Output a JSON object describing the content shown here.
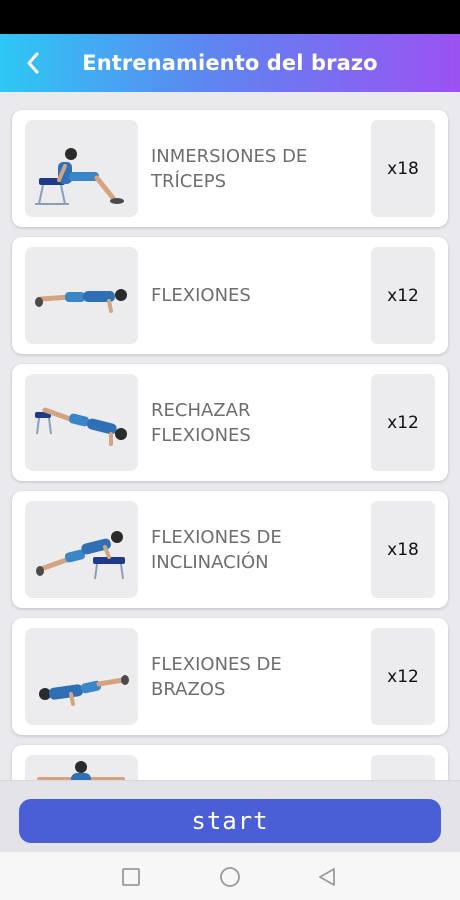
{
  "app_bar": {
    "title": "Entrenamiento del brazo",
    "back_icon": "chevron-left-icon",
    "gradient": [
      "#2ec8f4",
      "#9b52f2"
    ]
  },
  "exercises": [
    {
      "name": "INMERSIONES DE TRÍCEPS",
      "reps": "x18"
    },
    {
      "name": "FLEXIONES",
      "reps": "x12"
    },
    {
      "name": "RECHAZAR FLEXIONES",
      "reps": "x12"
    },
    {
      "name": "FLEXIONES DE INCLINACIÓN",
      "reps": "x18"
    },
    {
      "name": "FLEXIONES DE BRAZOS",
      "reps": "x12"
    },
    {
      "name": "",
      "reps": ""
    }
  ],
  "start_button": {
    "label": "start",
    "color": "#4a5fd6"
  },
  "system_nav": {
    "icons": [
      "square-icon",
      "circle-icon",
      "triangle-back-icon"
    ]
  }
}
